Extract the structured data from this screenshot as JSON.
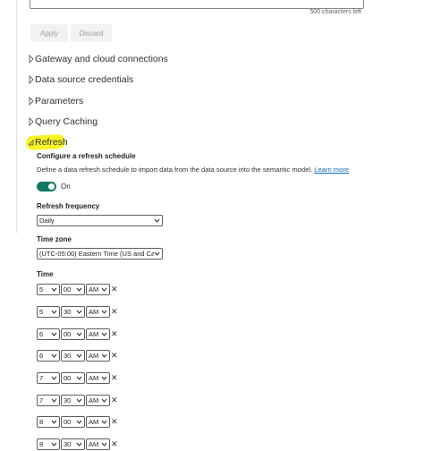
{
  "top": {
    "char_count": "500 characters left",
    "apply_label": "Apply",
    "discard_label": "Discard"
  },
  "sections": [
    {
      "label": "Gateway and cloud connections",
      "state": "collapsed"
    },
    {
      "label": "Data source credentials",
      "state": "collapsed"
    },
    {
      "label": "Parameters",
      "state": "collapsed"
    },
    {
      "label": "Query Caching",
      "state": "collapsed"
    },
    {
      "label": "Refresh",
      "state": "expanded"
    }
  ],
  "refresh": {
    "configure_title": "Configure a refresh schedule",
    "description": "Define a data refresh schedule to import data from the data source into the semantic model.",
    "learn_more": "Learn more",
    "toggle_label": "On",
    "toggle_on": true,
    "frequency_label": "Refresh frequency",
    "frequency_value": "Daily",
    "timezone_label": "Time zone",
    "timezone_value": "(UTC-05:00) Eastern Time (US and Ca",
    "time_label": "Time",
    "times": [
      {
        "hour": "5",
        "minute": "00",
        "ampm": "AM"
      },
      {
        "hour": "5",
        "minute": "30",
        "ampm": "AM"
      },
      {
        "hour": "6",
        "minute": "00",
        "ampm": "AM"
      },
      {
        "hour": "6",
        "minute": "30",
        "ampm": "AM"
      },
      {
        "hour": "7",
        "minute": "00",
        "ampm": "AM"
      },
      {
        "hour": "7",
        "minute": "30",
        "ampm": "AM"
      },
      {
        "hour": "8",
        "minute": "00",
        "ampm": "AM"
      },
      {
        "hour": "8",
        "minute": "30",
        "ampm": "AM"
      }
    ]
  },
  "colors": {
    "toggle_on": "#117865",
    "link": "#0f6cbd",
    "highlight": "#f7f200"
  }
}
